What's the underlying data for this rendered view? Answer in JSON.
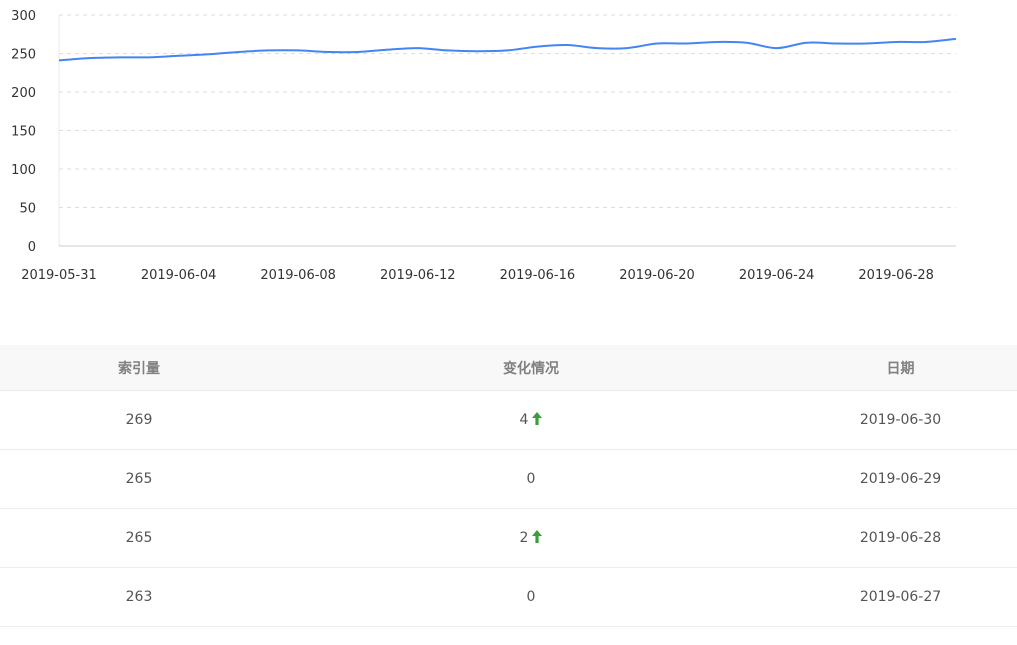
{
  "chart_data": {
    "type": "line",
    "title": "",
    "xlabel": "",
    "ylabel": "",
    "ylim": [
      0,
      300
    ],
    "yticks": [
      0,
      50,
      100,
      150,
      200,
      250,
      300
    ],
    "grid": true,
    "x_tick_labels": [
      "2019-05-31",
      "2019-06-04",
      "2019-06-08",
      "2019-06-12",
      "2019-06-16",
      "2019-06-20",
      "2019-06-24",
      "2019-06-28"
    ],
    "x": [
      "2019-05-31",
      "2019-06-01",
      "2019-06-02",
      "2019-06-03",
      "2019-06-04",
      "2019-06-05",
      "2019-06-06",
      "2019-06-07",
      "2019-06-08",
      "2019-06-09",
      "2019-06-10",
      "2019-06-11",
      "2019-06-12",
      "2019-06-13",
      "2019-06-14",
      "2019-06-15",
      "2019-06-16",
      "2019-06-17",
      "2019-06-18",
      "2019-06-19",
      "2019-06-20",
      "2019-06-21",
      "2019-06-22",
      "2019-06-23",
      "2019-06-24",
      "2019-06-25",
      "2019-06-26",
      "2019-06-27",
      "2019-06-28",
      "2019-06-29",
      "2019-06-30"
    ],
    "series": [
      {
        "name": "",
        "color": "#4285f4",
        "values": [
          241,
          244,
          245,
          245,
          247,
          249,
          252,
          254,
          254,
          252,
          252,
          255,
          257,
          254,
          253,
          254,
          259,
          261,
          257,
          257,
          263,
          263,
          265,
          264,
          257,
          264,
          263,
          263,
          265,
          265,
          269
        ]
      }
    ]
  },
  "table": {
    "headers": [
      "索引量",
      "变化情况",
      "日期"
    ],
    "rows": [
      {
        "count": "269",
        "change": "4",
        "up": true,
        "date": "2019-06-30"
      },
      {
        "count": "265",
        "change": "0",
        "up": false,
        "date": "2019-06-29"
      },
      {
        "count": "265",
        "change": "2",
        "up": true,
        "date": "2019-06-28"
      },
      {
        "count": "263",
        "change": "0",
        "up": false,
        "date": "2019-06-27"
      }
    ],
    "up_color": "#3a9d3a"
  }
}
